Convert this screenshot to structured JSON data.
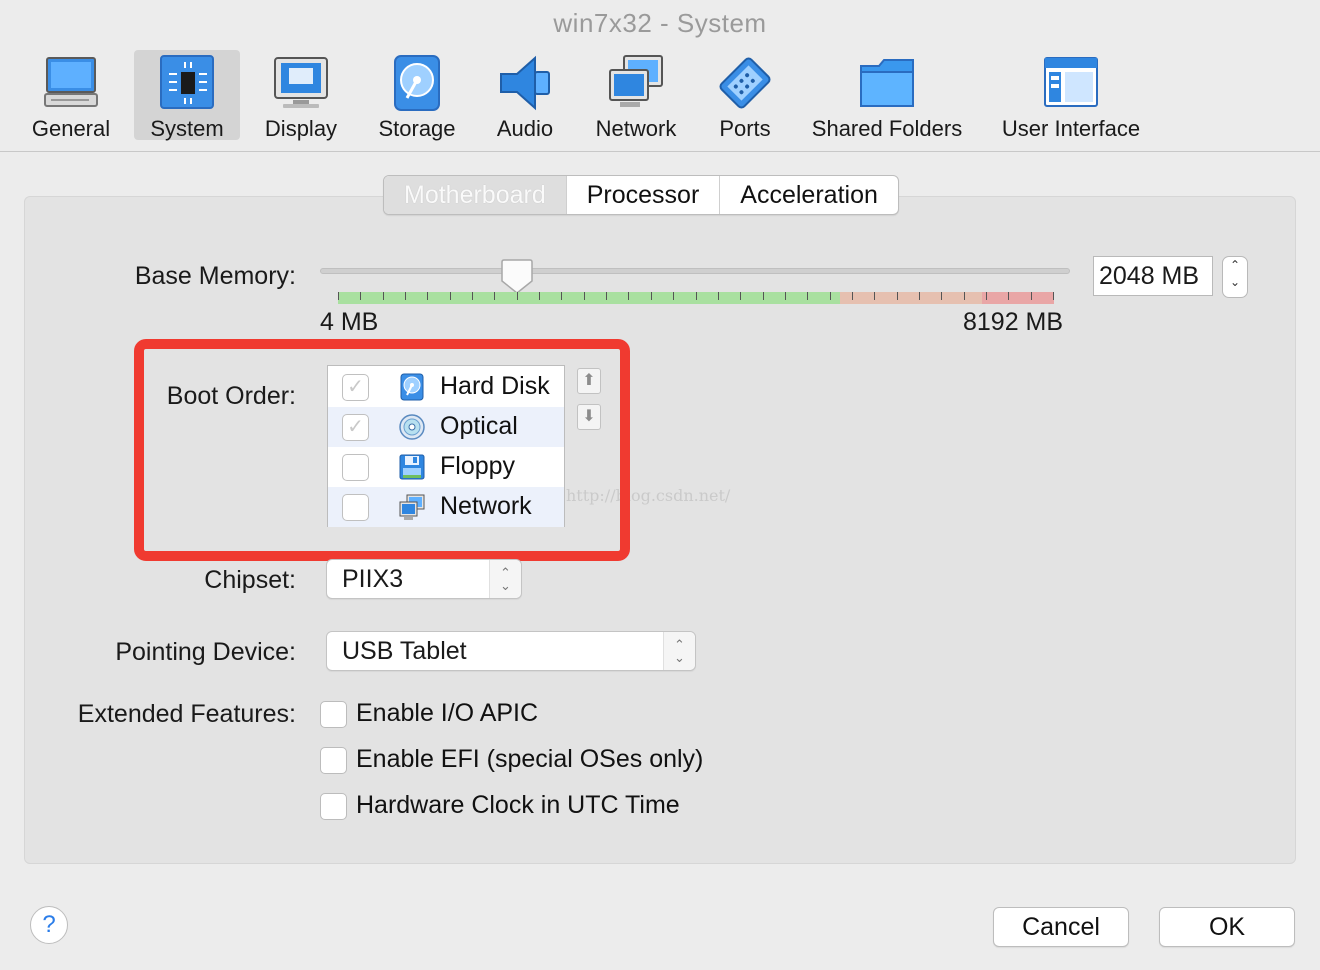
{
  "window": {
    "title": "win7x32 - System"
  },
  "toolbar": {
    "items": [
      {
        "label": "General",
        "icon": "general-icon"
      },
      {
        "label": "System",
        "icon": "system-chip-icon",
        "active": true
      },
      {
        "label": "Display",
        "icon": "display-monitor-icon"
      },
      {
        "label": "Storage",
        "icon": "storage-disk-icon"
      },
      {
        "label": "Audio",
        "icon": "audio-speaker-icon"
      },
      {
        "label": "Network",
        "icon": "network-monitors-icon"
      },
      {
        "label": "Ports",
        "icon": "ports-connector-icon"
      },
      {
        "label": "Shared Folders",
        "icon": "shared-folder-icon"
      },
      {
        "label": "User Interface",
        "icon": "user-interface-window-icon"
      }
    ]
  },
  "tabs": [
    {
      "label": "Motherboard",
      "active": true
    },
    {
      "label": "Processor"
    },
    {
      "label": "Acceleration"
    }
  ],
  "base_memory": {
    "label": "Base Memory:",
    "value": "2048 MB",
    "min_label": "4 MB",
    "max_label": "8192 MB",
    "slider_fraction": 0.25
  },
  "boot_order": {
    "label": "Boot Order:",
    "items": [
      {
        "label": "Hard Disk",
        "checked": true,
        "icon": "hard-disk-icon"
      },
      {
        "label": "Optical",
        "checked": true,
        "icon": "optical-disc-icon"
      },
      {
        "label": "Floppy",
        "checked": false,
        "icon": "floppy-disk-icon"
      },
      {
        "label": "Network",
        "checked": false,
        "icon": "network-icon"
      }
    ]
  },
  "watermark": "http://blog.csdn.net/",
  "chipset": {
    "label": "Chipset:",
    "value": "PIIX3"
  },
  "pointing_device": {
    "label": "Pointing Device:",
    "value": "USB Tablet"
  },
  "extended_features": {
    "label": "Extended Features:",
    "options": [
      {
        "label": "Enable I/O APIC",
        "checked": false
      },
      {
        "label": "Enable EFI (special OSes only)",
        "checked": false
      },
      {
        "label": "Hardware Clock in UTC Time",
        "checked": false
      }
    ]
  },
  "footer": {
    "help": "?",
    "cancel": "Cancel",
    "ok": "OK"
  },
  "colors": {
    "highlight": "#f03a30",
    "accent": "#2b7de9"
  }
}
